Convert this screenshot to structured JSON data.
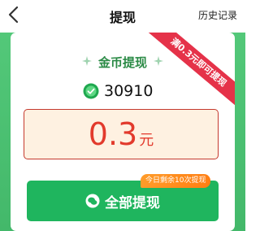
{
  "header": {
    "title": "提现",
    "history_label": "历史记录"
  },
  "card": {
    "ribbon_text": "满0.3元即可提现",
    "section_title": "金币提现",
    "coin_balance": "30910",
    "amount_value": "0.3",
    "amount_unit": "元",
    "remaining_tip": "今日剩余10次提现",
    "withdraw_button_label": "全部提现"
  },
  "colors": {
    "accent_green": "#1fb55e",
    "amount_red": "#e23a2c",
    "ribbon_red": "#e53249",
    "tip_orange": "#ff8b1d"
  },
  "icons": {
    "back": "chevron-left-icon",
    "coin": "coin-icon",
    "sparkle": "sparkle-icon",
    "wechat": "wechat-icon"
  }
}
